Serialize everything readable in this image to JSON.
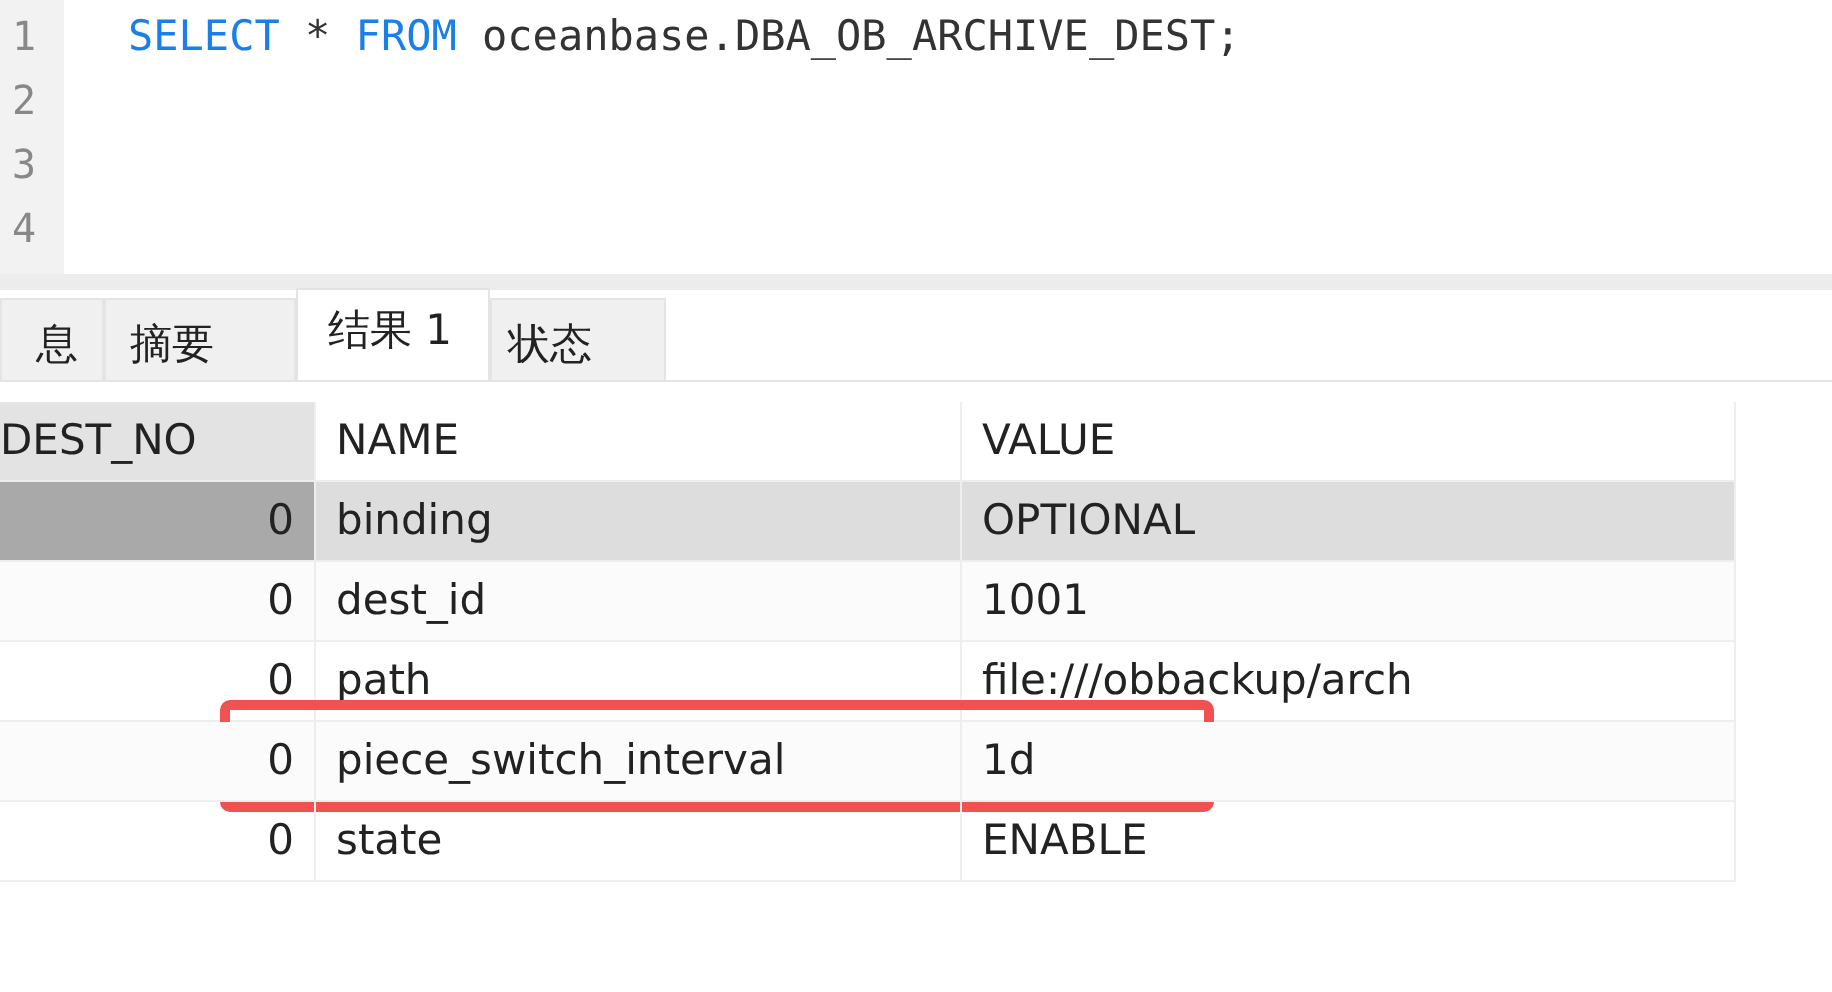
{
  "editor": {
    "lines": [
      {
        "number": "1",
        "tokens": [
          {
            "kind": "keyword",
            "text": "SELECT"
          },
          {
            "kind": "plain",
            "text": " * "
          },
          {
            "kind": "keyword",
            "text": "FROM"
          },
          {
            "kind": "plain",
            "text": " oceanbase.DBA_OB_ARCHIVE_DEST;"
          }
        ]
      },
      {
        "number": "2"
      },
      {
        "number": "3"
      },
      {
        "number": "4"
      }
    ]
  },
  "tabs": [
    {
      "label": "息",
      "selected": false
    },
    {
      "label": "摘要",
      "selected": false
    },
    {
      "label": "结果 1",
      "selected": true
    },
    {
      "label": "状态",
      "selected": false
    }
  ],
  "table": {
    "columns": [
      "DEST_NO",
      "NAME",
      "VALUE"
    ],
    "rows": [
      {
        "cells": [
          "0",
          "binding",
          "OPTIONAL"
        ],
        "selected": true,
        "highlighted": false
      },
      {
        "cells": [
          "0",
          "dest_id",
          "1001"
        ],
        "selected": false,
        "highlighted": false
      },
      {
        "cells": [
          "0",
          "path",
          "file:///obbackup/arch"
        ],
        "selected": false,
        "highlighted": false
      },
      {
        "cells": [
          "0",
          "piece_switch_interval",
          "1d"
        ],
        "selected": false,
        "highlighted": true
      },
      {
        "cells": [
          "0",
          "state",
          "ENABLE"
        ],
        "selected": false,
        "highlighted": false
      }
    ]
  }
}
